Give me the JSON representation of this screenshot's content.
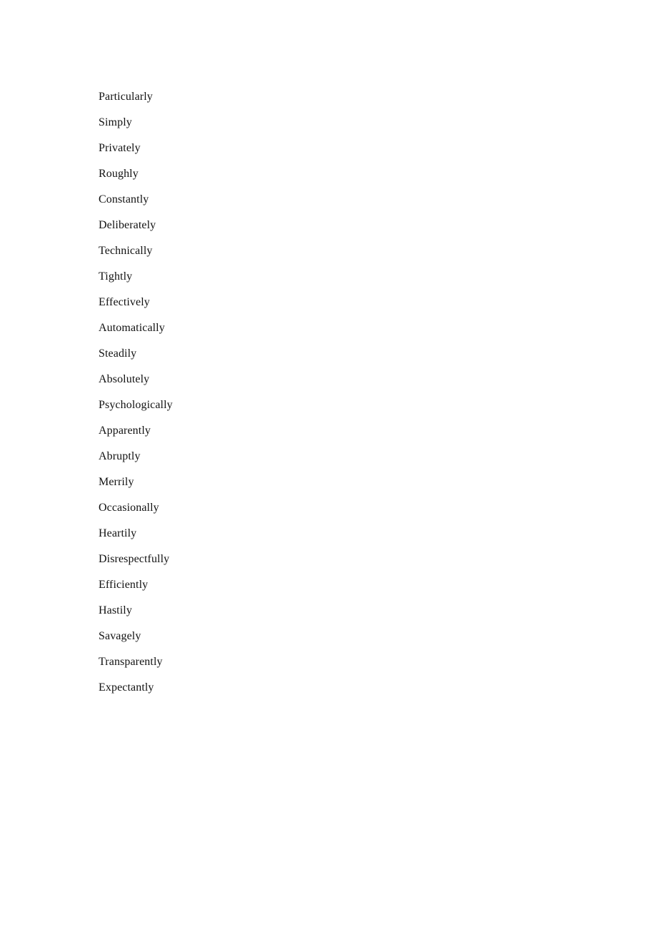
{
  "document": {
    "page_background": "#ffffff",
    "text_color": "#121212",
    "body_lines": [
      {
        "text": "Particularly"
      },
      {
        "text": "Simply"
      },
      {
        "text": "Privately"
      },
      {
        "text": "Roughly"
      },
      {
        "text": "Constantly"
      },
      {
        "text": "Deliberately"
      },
      {
        "text": "Technically"
      },
      {
        "text": "Tightly"
      },
      {
        "text": "Effectively"
      },
      {
        "text": "Automatically"
      },
      {
        "text": "Steadily"
      },
      {
        "text": "Absolutely"
      },
      {
        "text": "Psychologically"
      },
      {
        "text": "Apparently"
      },
      {
        "text": "Abruptly"
      },
      {
        "text": "Merrily"
      },
      {
        "text": "Occasionally"
      },
      {
        "text": "Heartily"
      },
      {
        "text": "Disrespectfully"
      },
      {
        "text": "Efficiently"
      },
      {
        "text": "Hastily"
      },
      {
        "text": "Savagely"
      },
      {
        "text": "Transparently"
      },
      {
        "text": "Expectantly"
      }
    ]
  }
}
